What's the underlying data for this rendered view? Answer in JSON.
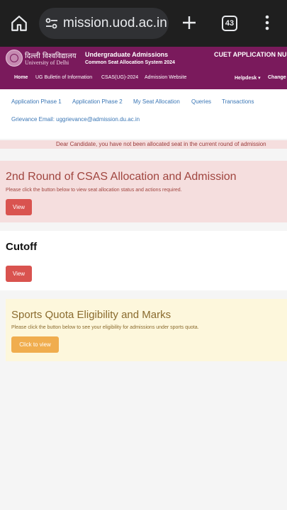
{
  "browser": {
    "url": "mission.uod.ac.in",
    "tab_count": "43",
    "icons": [
      "home-icon",
      "tune-icon",
      "plus-icon",
      "tab-switcher-icon",
      "kebab-menu-icon"
    ]
  },
  "header": {
    "university_hindi": "दिल्ली विश्वविद्यालय",
    "university_english": "University of Delhi",
    "system_title": "Undergraduate Admissions",
    "system_subtitle": "Common Seat Allocation System 2024",
    "cuet_label": "CUET APPLICATION NUMB",
    "brand_color": "#7a1a5c"
  },
  "nav": {
    "home": "Home",
    "bulletin": "UG Bulletin of Information",
    "csas": "CSAS(UG)-2024",
    "website": "Admission Website",
    "helpdesk": "Helpdesk ▾",
    "change": "Change"
  },
  "tabs": {
    "phase1": "Application Phase 1",
    "phase2": "Application Phase 2",
    "seat": "My Seat Allocation",
    "queries": "Queries",
    "transactions": "Transactions"
  },
  "grievance": "Grievance Email: uggrievance@admission.du.ac.in",
  "notice": "Dear Candidate, you have not been allocated seat in the current round of admission",
  "allocation": {
    "title": "2nd Round of CSAS Allocation and Admission",
    "text": "Please click the button below to view seat allocation status and actions required.",
    "button": "View"
  },
  "cutoff": {
    "title": "Cutoff",
    "button": "View"
  },
  "sports": {
    "title": "Sports Quota Eligibility and Marks",
    "text": "Please click the button below to see your eligibility for admissions under sports quota.",
    "button": "Click to view"
  }
}
